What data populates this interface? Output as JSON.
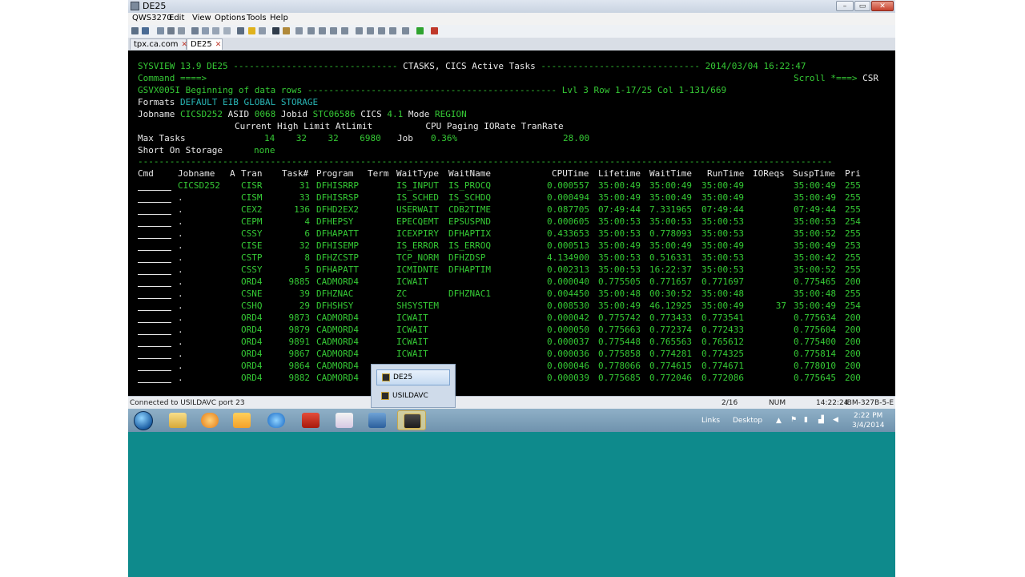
{
  "window": {
    "title": "DE25",
    "minimize": "–",
    "maximize": "▭",
    "close": "✕"
  },
  "menu": [
    "QWS3270",
    "Edit",
    "View",
    "Options",
    "Tools",
    "Help"
  ],
  "tabs": [
    {
      "label": "tpx.ca.com",
      "close": "✕"
    },
    {
      "label": "DE25",
      "close": "✕"
    }
  ],
  "header": {
    "line1_left": "SYSVIEW 13.9 DE25",
    "line1_dashes_a": " ------------------------------- ",
    "line1_title": "CTASKS, CICS Active Tasks",
    "line1_dashes_b": " ------------------------------ ",
    "line1_date": "2014/03/04 16:22:47",
    "command_label": "Command ====>",
    "scroll_label": "Scroll *===>",
    "scroll_value": "CSR",
    "msg": "GSVX005I Beginning of data rows ----------------------------------------------- Lvl 3 Row 1-17/25 Col 1-131/669",
    "formats_label": "Formats",
    "formats_value": "DEFAULT EIB GLOBAL STORAGE",
    "jobname_label": "Jobname",
    "jobname_value": "CICSD252",
    "asid_label": "ASID",
    "asid_value": "0068",
    "jobid_label": "Jobid",
    "jobid_value": "STC06586",
    "cics_label": "CICS",
    "cics_value": "4.1",
    "mode_label": "Mode",
    "mode_value": "REGION",
    "stats_header": "Current High Limit AtLimit          CPU Paging IORate TranRate",
    "max_tasks_label": "Max Tasks",
    "max_tasks_values": "14    32    32    6980",
    "job_label": "Job",
    "job_cpu": "0.36%",
    "tranrate": "28.00",
    "sos_label": "Short On Storage",
    "sos_value": "none",
    "separator": "-----------------------------------------------------------------------------------------------------------------------------------"
  },
  "columns": [
    "Cmd",
    "Jobname",
    "A",
    "Tran",
    "Task#",
    "Program",
    "Term",
    "WaitType",
    "WaitName",
    "CPUTime",
    "Lifetime",
    "WaitTime",
    "RunTime",
    "IOReqs",
    "SuspTime",
    "Pri"
  ],
  "rows": [
    {
      "jobname": "CICSD252",
      "tran": "CISR",
      "task": "31",
      "program": "DFHISRRP",
      "waittype": "IS_INPUT",
      "waitname": "IS_PROCQ",
      "cpu": "0.000557",
      "life": "35:00:49",
      "wait": "35:00:49",
      "run": "35:00:49",
      "io": "",
      "susp": "35:00:49",
      "pri": "255"
    },
    {
      "jobname": ".",
      "tran": "CISM",
      "task": "33",
      "program": "DFHISRSP",
      "waittype": "IS_SCHED",
      "waitname": "IS_SCHDQ",
      "cpu": "0.000494",
      "life": "35:00:49",
      "wait": "35:00:49",
      "run": "35:00:49",
      "io": "",
      "susp": "35:00:49",
      "pri": "255"
    },
    {
      "jobname": ".",
      "tran": "CEX2",
      "task": "136",
      "program": "DFHD2EX2",
      "waittype": "USERWAIT",
      "waitname": "CDB2TIME",
      "cpu": "0.087705",
      "life": "07:49:44",
      "wait": "7.331965",
      "run": "07:49:44",
      "io": "",
      "susp": "07:49:44",
      "pri": "255"
    },
    {
      "jobname": ".",
      "tran": "CEPM",
      "task": "4",
      "program": "DFHEPSY",
      "waittype": "EPECQEMT",
      "waitname": "EPSUSPND",
      "cpu": "0.000605",
      "life": "35:00:53",
      "wait": "35:00:53",
      "run": "35:00:53",
      "io": "",
      "susp": "35:00:53",
      "pri": "254"
    },
    {
      "jobname": ".",
      "tran": "CSSY",
      "task": "6",
      "program": "DFHAPATT",
      "waittype": "ICEXPIRY",
      "waitname": "DFHAPTIX",
      "cpu": "0.433653",
      "life": "35:00:53",
      "wait": "0.778093",
      "run": "35:00:53",
      "io": "",
      "susp": "35:00:52",
      "pri": "255"
    },
    {
      "jobname": ".",
      "tran": "CISE",
      "task": "32",
      "program": "DFHISEMP",
      "waittype": "IS_ERROR",
      "waitname": "IS_ERROQ",
      "cpu": "0.000513",
      "life": "35:00:49",
      "wait": "35:00:49",
      "run": "35:00:49",
      "io": "",
      "susp": "35:00:49",
      "pri": "253"
    },
    {
      "jobname": ".",
      "tran": "CSTP",
      "task": "8",
      "program": "DFHZCSTP",
      "waittype": "TCP_NORM",
      "waitname": "DFHZDSP",
      "cpu": "4.134900",
      "life": "35:00:53",
      "wait": "0.516331",
      "run": "35:00:53",
      "io": "",
      "susp": "35:00:42",
      "pri": "255"
    },
    {
      "jobname": ".",
      "tran": "CSSY",
      "task": "5",
      "program": "DFHAPATT",
      "waittype": "ICMIDNTE",
      "waitname": "DFHAPTIM",
      "cpu": "0.002313",
      "life": "35:00:53",
      "wait": "16:22:37",
      "run": "35:00:53",
      "io": "",
      "susp": "35:00:52",
      "pri": "255"
    },
    {
      "jobname": ".",
      "tran": "ORD4",
      "task": "9885",
      "program": "CADMORD4",
      "waittype": "ICWAIT",
      "waitname": "",
      "cpu": "0.000040",
      "life": "0.775505",
      "wait": "0.771657",
      "run": "0.771697",
      "io": "",
      "susp": "0.775465",
      "pri": "200"
    },
    {
      "jobname": ".",
      "tran": "CSNE",
      "task": "39",
      "program": "DFHZNAC",
      "waittype": "ZC",
      "waitname": "DFHZNAC1",
      "cpu": "0.004450",
      "life": "35:00:48",
      "wait": "00:30:52",
      "run": "35:00:48",
      "io": "",
      "susp": "35:00:48",
      "pri": "255"
    },
    {
      "jobname": ".",
      "tran": "CSHQ",
      "task": "29",
      "program": "DFHSHSY",
      "waittype": "SHSYSTEM",
      "waitname": "",
      "cpu": "0.008530",
      "life": "35:00:49",
      "wait": "46.12925",
      "run": "35:00:49",
      "io": "37",
      "susp": "35:00:49",
      "pri": "254"
    },
    {
      "jobname": ".",
      "tran": "ORD4",
      "task": "9873",
      "program": "CADMORD4",
      "waittype": "ICWAIT",
      "waitname": "",
      "cpu": "0.000042",
      "life": "0.775742",
      "wait": "0.773433",
      "run": "0.773541",
      "io": "",
      "susp": "0.775634",
      "pri": "200"
    },
    {
      "jobname": ".",
      "tran": "ORD4",
      "task": "9879",
      "program": "CADMORD4",
      "waittype": "ICWAIT",
      "waitname": "",
      "cpu": "0.000050",
      "life": "0.775663",
      "wait": "0.772374",
      "run": "0.772433",
      "io": "",
      "susp": "0.775604",
      "pri": "200"
    },
    {
      "jobname": ".",
      "tran": "ORD4",
      "task": "9891",
      "program": "CADMORD4",
      "waittype": "ICWAIT",
      "waitname": "",
      "cpu": "0.000037",
      "life": "0.775448",
      "wait": "0.765563",
      "run": "0.765612",
      "io": "",
      "susp": "0.775400",
      "pri": "200"
    },
    {
      "jobname": ".",
      "tran": "ORD4",
      "task": "9867",
      "program": "CADMORD4",
      "waittype": "ICWAIT",
      "waitname": "",
      "cpu": "0.000036",
      "life": "0.775858",
      "wait": "0.774281",
      "run": "0.774325",
      "io": "",
      "susp": "0.775814",
      "pri": "200"
    },
    {
      "jobname": ".",
      "tran": "ORD4",
      "task": "9864",
      "program": "CADMORD4",
      "waittype": "",
      "waitname": "",
      "cpu": "0.000046",
      "life": "0.778066",
      "wait": "0.774615",
      "run": "0.774671",
      "io": "",
      "susp": "0.778010",
      "pri": "200"
    },
    {
      "jobname": ".",
      "tran": "ORD4",
      "task": "9882",
      "program": "CADMORD4",
      "waittype": "",
      "waitname": "",
      "cpu": "0.000039",
      "life": "0.775685",
      "wait": "0.772046",
      "run": "0.772086",
      "io": "",
      "susp": "0.775645",
      "pri": "200"
    }
  ],
  "status": {
    "connection": "Connected to USILDAVC port 23",
    "page": "2/16",
    "num": "NUM",
    "time": "14:22:24",
    "model": "IBM-327B-5-E"
  },
  "popup": {
    "items": [
      "DE25",
      "USILDAVC"
    ]
  },
  "taskbar": {
    "links": "Links",
    "desktop": "Desktop",
    "clock_time": "2:22 PM",
    "clock_date": "3/4/2014",
    "icons": [
      "explorer-icon",
      "media-player-icon",
      "outlook-icon",
      "internet-explorer-icon",
      "filezilla-icon",
      "onenote-icon",
      "qws-icon",
      "terminal-icon"
    ]
  },
  "colors": {
    "terminal_bg": "#000000",
    "terminal_green": "#35c935",
    "terminal_white": "#e8e8e8",
    "terminal_teal": "#28b4b4",
    "desktop_teal": "#0e8a8c"
  }
}
